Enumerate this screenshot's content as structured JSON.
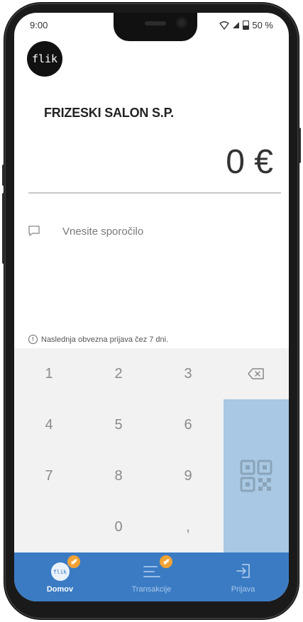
{
  "status_bar": {
    "time": "9:00",
    "battery": "50 %"
  },
  "header": {
    "logo_text": "flik"
  },
  "merchant": {
    "name": "FRIZESKI SALON S.P."
  },
  "payment": {
    "amount": "0 €",
    "message_placeholder": "Vnesite sporočilo"
  },
  "notice": {
    "text": "Naslednja obvezna prijava čez 7 dni."
  },
  "keypad": {
    "keys": [
      "1",
      "2",
      "3",
      "4",
      "5",
      "6",
      "7",
      "8",
      "9",
      "0",
      ","
    ],
    "backspace_icon": "backspace-icon",
    "qr_icon": "qr-code-icon"
  },
  "bottom_nav": {
    "items": [
      {
        "label": "Domov",
        "icon": "flik-home-icon",
        "icon_text": "flik",
        "badge": true,
        "active": true
      },
      {
        "label": "Transakcije",
        "icon": "list-icon",
        "badge": true,
        "active": false
      },
      {
        "label": "Prijava",
        "icon": "login-icon",
        "badge": false,
        "active": false
      }
    ]
  },
  "colors": {
    "nav_background": "#3a7bc4",
    "qr_key_background": "#a8c8e4",
    "badge": "#f3a233",
    "keypad_background": "#f2f2f2"
  }
}
